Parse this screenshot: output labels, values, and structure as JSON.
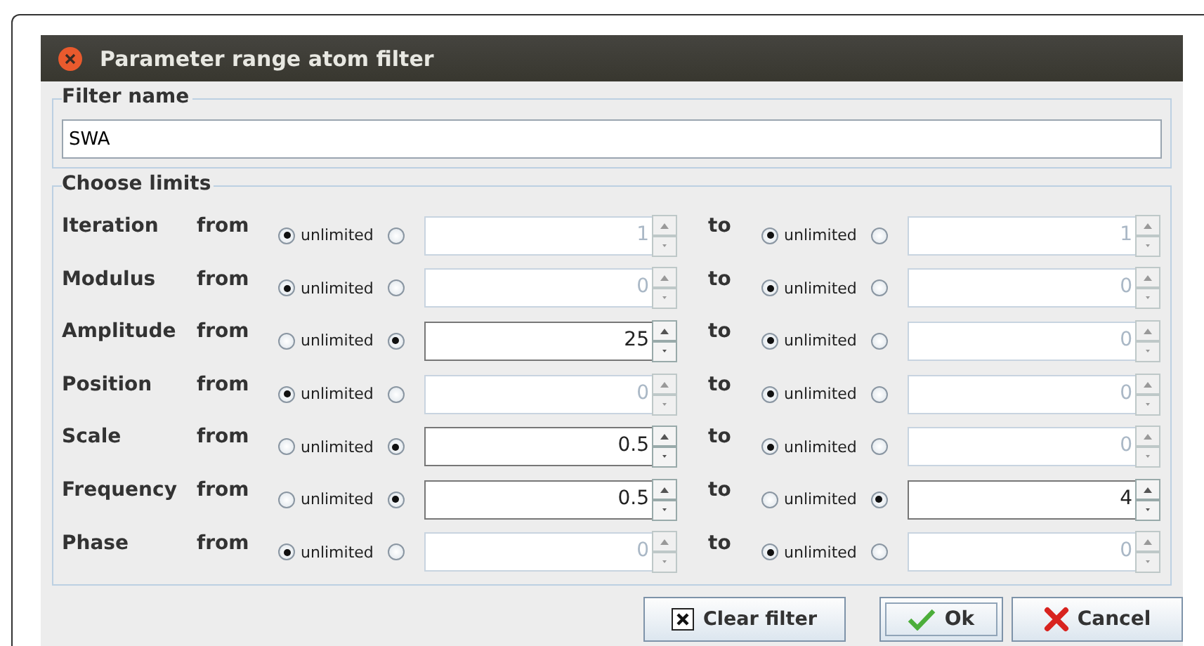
{
  "window": {
    "title": "Parameter range atom filter"
  },
  "filter_name": {
    "legend": "Filter name",
    "value": "SWA"
  },
  "limits": {
    "legend": "Choose limits",
    "rows": [
      {
        "name": "Iteration",
        "from_label": "from",
        "from": {
          "unlimited": true,
          "unlimited_label": "unlimited",
          "value": "1"
        },
        "to_label": "to",
        "to": {
          "unlimited": true,
          "unlimited_label": "unlimited",
          "value": "1"
        }
      },
      {
        "name": "Modulus",
        "from_label": "from",
        "from": {
          "unlimited": true,
          "unlimited_label": "unlimited",
          "value": "0"
        },
        "to_label": "to",
        "to": {
          "unlimited": true,
          "unlimited_label": "unlimited",
          "value": "0"
        }
      },
      {
        "name": "Amplitude",
        "from_label": "from",
        "from": {
          "unlimited": false,
          "unlimited_label": "unlimited",
          "value": "25"
        },
        "to_label": "to",
        "to": {
          "unlimited": true,
          "unlimited_label": "unlimited",
          "value": "0"
        }
      },
      {
        "name": "Position",
        "from_label": "from",
        "from": {
          "unlimited": true,
          "unlimited_label": "unlimited",
          "value": "0"
        },
        "to_label": "to",
        "to": {
          "unlimited": true,
          "unlimited_label": "unlimited",
          "value": "0"
        }
      },
      {
        "name": "Scale",
        "from_label": "from",
        "from": {
          "unlimited": false,
          "unlimited_label": "unlimited",
          "value": "0.5"
        },
        "to_label": "to",
        "to": {
          "unlimited": true,
          "unlimited_label": "unlimited",
          "value": "0"
        }
      },
      {
        "name": "Frequency",
        "from_label": "from",
        "from": {
          "unlimited": false,
          "unlimited_label": "unlimited",
          "value": "0.5"
        },
        "to_label": "to",
        "to": {
          "unlimited": false,
          "unlimited_label": "unlimited",
          "value": "4"
        }
      },
      {
        "name": "Phase",
        "from_label": "from",
        "from": {
          "unlimited": true,
          "unlimited_label": "unlimited",
          "value": "0"
        },
        "to_label": "to",
        "to": {
          "unlimited": true,
          "unlimited_label": "unlimited",
          "value": "0"
        }
      }
    ]
  },
  "buttons": [
    {
      "kind": "clear",
      "label": "Clear filter"
    },
    {
      "kind": "ok",
      "label": "Ok"
    },
    {
      "kind": "cancel",
      "label": "Cancel"
    }
  ]
}
